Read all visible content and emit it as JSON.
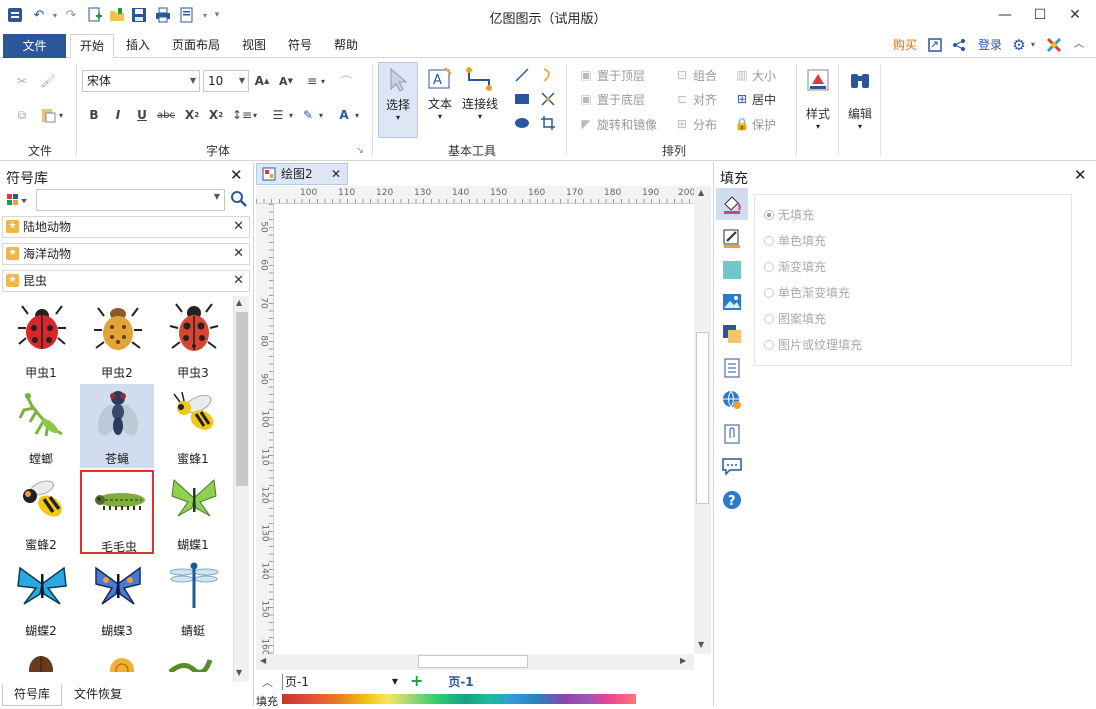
{
  "app": {
    "title": "亿图图示（试用版）"
  },
  "window_controls": {
    "minimize": "—",
    "maximize": "☐",
    "close": "✕"
  },
  "menu": {
    "file": "文件",
    "tabs": [
      "开始",
      "插入",
      "页面布局",
      "视图",
      "符号",
      "帮助"
    ],
    "buy": "购买",
    "login": "登录"
  },
  "ribbon": {
    "file_group": "文件",
    "font_group": "字体",
    "font_name": "宋体",
    "font_size": "10",
    "basic_tools_group": "基本工具",
    "select": "选择",
    "text": "文本",
    "connector": "连接线",
    "arrange_group": "排列",
    "bring_front": "置于顶层",
    "send_back": "置于底层",
    "rotate_mirror": "旋转和镜像",
    "group": "组合",
    "align": "对齐",
    "distribute": "分布",
    "size": "大小",
    "center": "居中",
    "protect": "保护",
    "style": "样式",
    "edit": "编辑"
  },
  "symbol_library": {
    "title": "符号库",
    "search_placeholder": "",
    "categories": [
      "陆地动物",
      "海洋动物",
      "昆虫"
    ],
    "symbols": [
      "甲虫1",
      "甲虫2",
      "甲虫3",
      "螳螂",
      "苍蝇",
      "蜜蜂1",
      "蜜蜂2",
      "毛毛虫",
      "蝴蝶1",
      "蝴蝶2",
      "蝴蝶3",
      "蜻蜓"
    ],
    "selected": "毛毛虫",
    "hovered": "苍蝇",
    "bottom_tabs": [
      "符号库",
      "文件恢复"
    ]
  },
  "document": {
    "tab": "绘图2",
    "ruler_h": [
      "100",
      "110",
      "120",
      "130",
      "140",
      "150",
      "160",
      "170",
      "180",
      "190",
      "200"
    ],
    "ruler_v": [
      "50",
      "60",
      "70",
      "80",
      "90",
      "100",
      "110",
      "120",
      "130",
      "140",
      "150",
      "160"
    ],
    "page_select": "页-1",
    "page_tab": "页-1",
    "fill_label": "填充"
  },
  "fill_panel": {
    "title": "填充",
    "options": [
      "无填充",
      "单色填充",
      "渐变填充",
      "单色渐变填充",
      "图案填充",
      "图片或纹理填充"
    ]
  },
  "colors": {
    "accent": "#2b579a",
    "buy": "#e36c09",
    "selection": "#e03030"
  }
}
